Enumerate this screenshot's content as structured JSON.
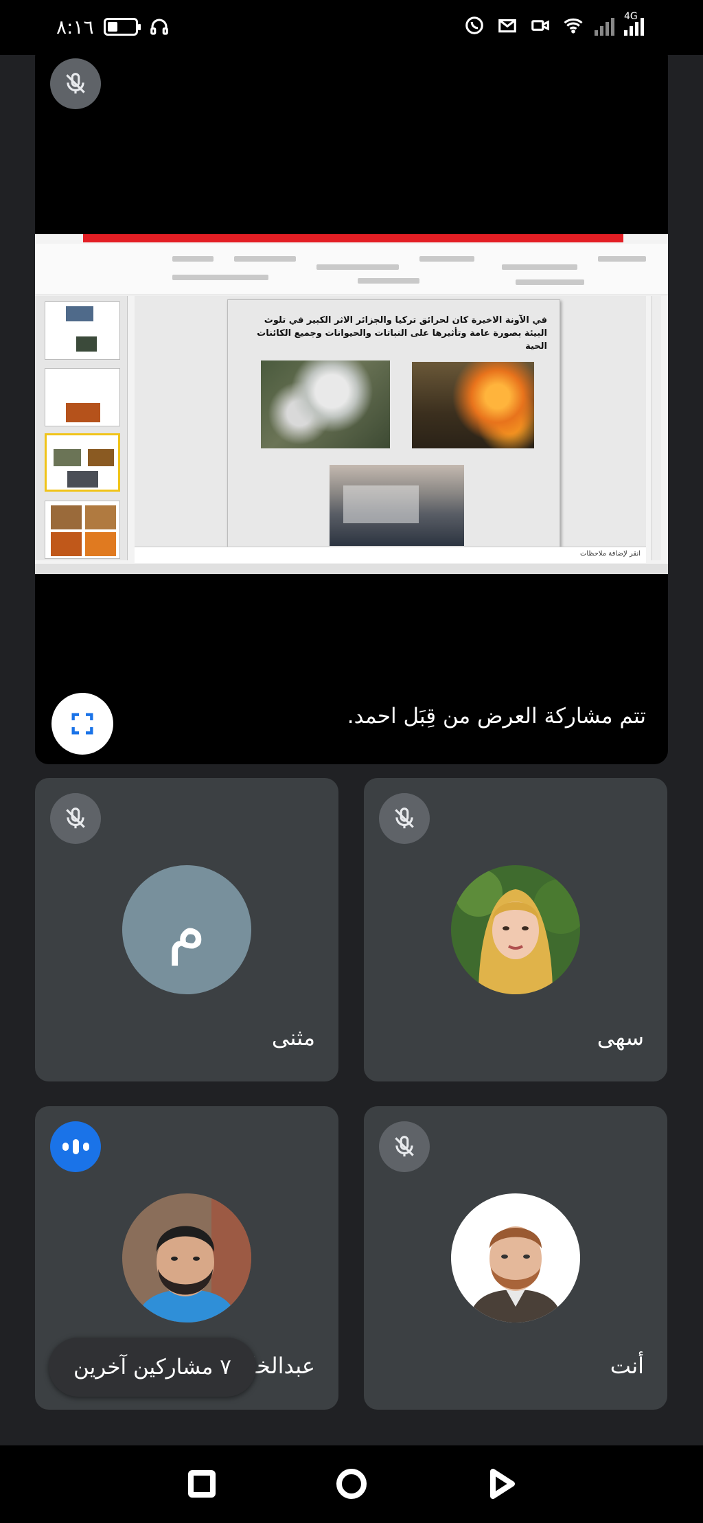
{
  "status_bar": {
    "time": "٨:١٦",
    "network_label_1": "4G",
    "icons": [
      "battery-icon",
      "headset-icon",
      "whatsapp-icon",
      "mail-icon",
      "video-icon",
      "wifi-icon",
      "signal-icon"
    ]
  },
  "screen_share": {
    "caption": "تتم مشاركة العرض من قِبَل احمد.",
    "slide_text": "في الآونة الاخيرة كان لحرائق تركيا والجزائر الاثر الكبير في تلوث البيئة بصورة عامة وتأثيرها على النباتات والحيوانات وجميع الكائنات الحية",
    "notes_placeholder": "انقر لإضافة ملاحظات"
  },
  "participants": [
    {
      "name": "مثنى",
      "initial": "م",
      "muted": true,
      "avatar_color": "#78909c"
    },
    {
      "name": "سهى",
      "muted": true
    },
    {
      "name": "عبدالخالق",
      "speaking": true
    },
    {
      "name": "أنت",
      "muted": true
    }
  ],
  "others_pill": "٧ مشاركين آخرين",
  "colors": {
    "background": "#202124",
    "tile": "#3c4043",
    "mic_off_badge": "#5f6368",
    "speaking_badge": "#1a73e8",
    "letter_avatar": "#78909c"
  }
}
